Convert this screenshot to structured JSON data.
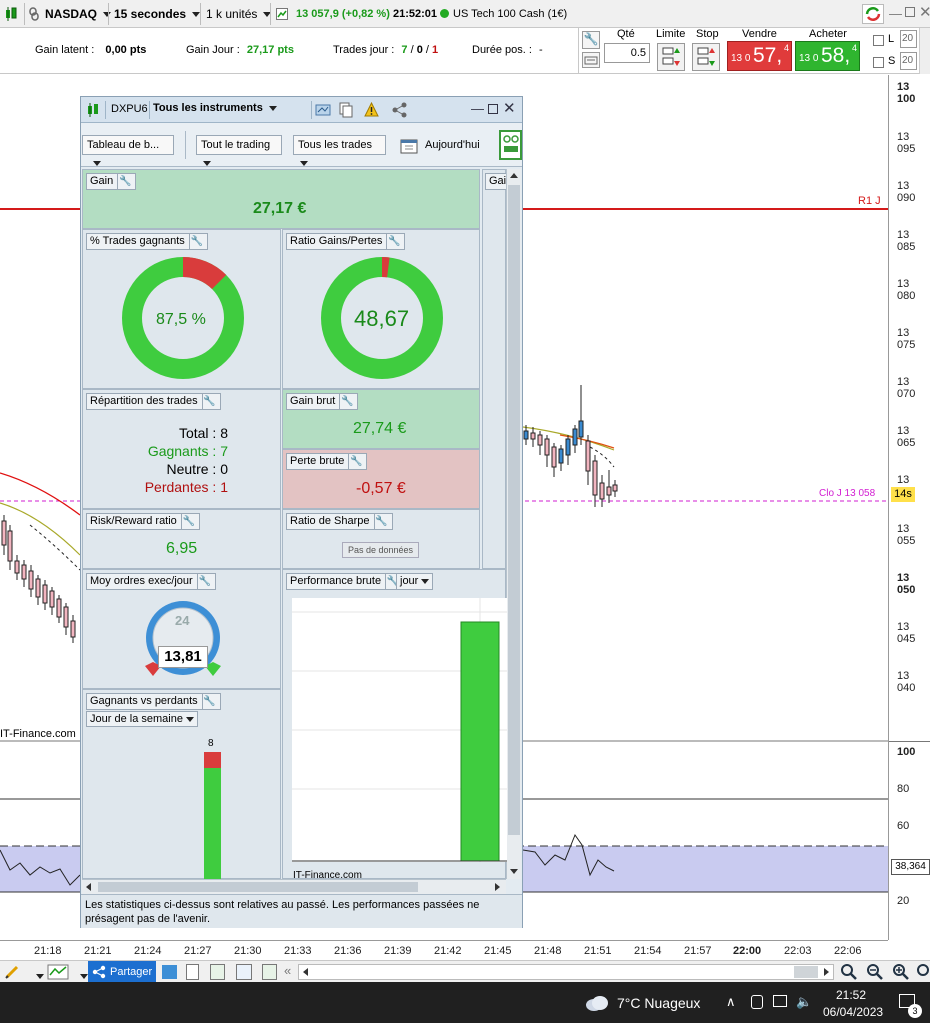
{
  "toolbar": {
    "instrument": "NASDAQ",
    "interval": "15 secondes",
    "units": "1 k unités",
    "quote": "13 057,9 (+0,82 %)",
    "time": "21:52:01",
    "instrument_name": "US Tech 100 Cash (1€)"
  },
  "infobar": {
    "gain_latent_label": "Gain latent :",
    "gain_latent_value": "0,00 pts",
    "gain_jour_label": "Gain Jour :",
    "gain_jour_value": "27,17 pts",
    "trades_jour_label": "Trades jour :",
    "trades_jour_a": "7",
    "trades_jour_b": "0",
    "trades_jour_c": "1",
    "duree_label": "Durée pos. :",
    "duree_value": "-",
    "qte_label": "Qté",
    "qte_value": "0.5",
    "limite_label": "Limite",
    "stop_label": "Stop",
    "vendre_label": "Vendre",
    "vendre_prefix": "13 0",
    "vendre_big": "57,",
    "vendre_sup": "4",
    "acheter_label": "Acheter",
    "acheter_prefix": "13 0",
    "acheter_big": "58,",
    "acheter_sup": "4",
    "l_label": "L",
    "s_label": "S",
    "l_value": "20",
    "s_value": "20"
  },
  "chart": {
    "r1_label": "R1 J",
    "clo_label": "Clo J 13 058",
    "clo_timer": "14s",
    "watermark": "IT-Finance.com",
    "price_ticks": [
      "13 100",
      "13 095",
      "13 090",
      "13 085",
      "13 080",
      "13 075",
      "13 070",
      "13 065",
      "13 060",
      "13 055",
      "13 050",
      "13 045",
      "13 040"
    ],
    "osc_ticks": [
      "100",
      "80",
      "60",
      "40",
      "20"
    ],
    "osc_value": "38,364",
    "time_ticks": [
      "21:18",
      "21:21",
      "21:24",
      "21:27",
      "21:30",
      "21:33",
      "21:36",
      "21:39",
      "21:42",
      "21:45",
      "21:48",
      "21:51",
      "21:54",
      "21:57",
      "22:00",
      "22:03",
      "22:06"
    ]
  },
  "panel": {
    "account": "DXPU6",
    "instruments": "Tous les instruments",
    "view": "Tableau de b...",
    "trading": "Tout le trading",
    "trades": "Tous les trades",
    "period": "Aujourd'hui",
    "gain_title": "Gain",
    "gain_value": "27,17 €",
    "side_tab": "Gai",
    "pct_title": "% Trades gagnants",
    "pct_value": "87,5 %",
    "pct_fraction": 0.875,
    "ratio_title": "Ratio Gains/Pertes",
    "ratio_value": "48,67",
    "ratio_fraction": 0.98,
    "repart_title": "Répartition des trades",
    "total_label": "Total :",
    "total_value": "8",
    "gagnants_label": "Gagnants :",
    "gagnants_value": "7",
    "neutre_label": "Neutre :",
    "neutre_value": "0",
    "perdantes_label": "Perdantes :",
    "perdantes_value": "1",
    "gain_brut_title": "Gain brut",
    "gain_brut_value": "27,74 €",
    "perte_brute_title": "Perte brute",
    "perte_brute_value": "-0,57 €",
    "rr_title": "Risk/Reward ratio",
    "rr_value": "6,95",
    "sharpe_title": "Ratio de Sharpe",
    "sharpe_value": "Pas de données",
    "moy_title": "Moy ordres exec/jour",
    "moy_dial": "24",
    "moy_value": "13,81",
    "perf_title": "Performance brute",
    "perf_period": "jour",
    "perf_watermark": "IT-Finance.com",
    "gvp_title": "Gagnants vs perdants",
    "gvp_period": "Jour de la semaine",
    "gvp_count": "8",
    "gvp_win_fraction": 0.875,
    "footer": "Les statistiques ci-dessus sont relatives au passé. Les performances passées ne présagent pas de l'avenir."
  },
  "bottombar": {
    "share": "Partager"
  },
  "taskbar": {
    "weather": "7°C  Nuageux",
    "time": "21:52",
    "date": "06/04/2023",
    "badge": "3"
  },
  "colors": {
    "green": "#3fcc3f",
    "red": "#d93c3c",
    "gain_bg": "#b3ddc2",
    "perte_bg": "#e3c3c3"
  }
}
